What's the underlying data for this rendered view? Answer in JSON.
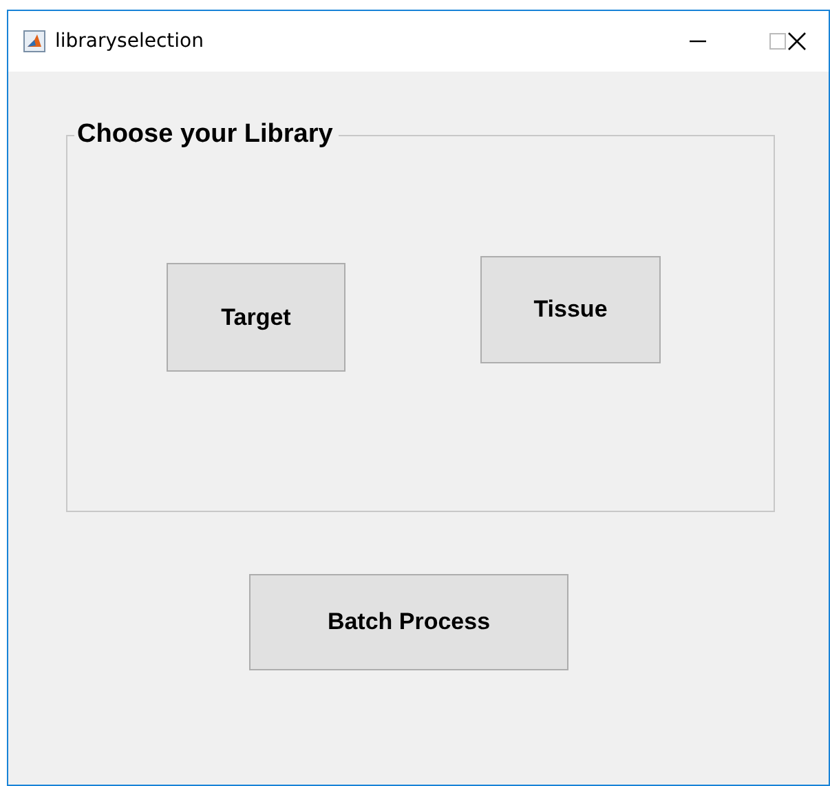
{
  "window": {
    "title": "libraryselection"
  },
  "panel": {
    "title": "Choose your Library",
    "buttons": [
      "Target",
      "Tissue"
    ]
  },
  "buttons": [
    "Batch Process"
  ]
}
